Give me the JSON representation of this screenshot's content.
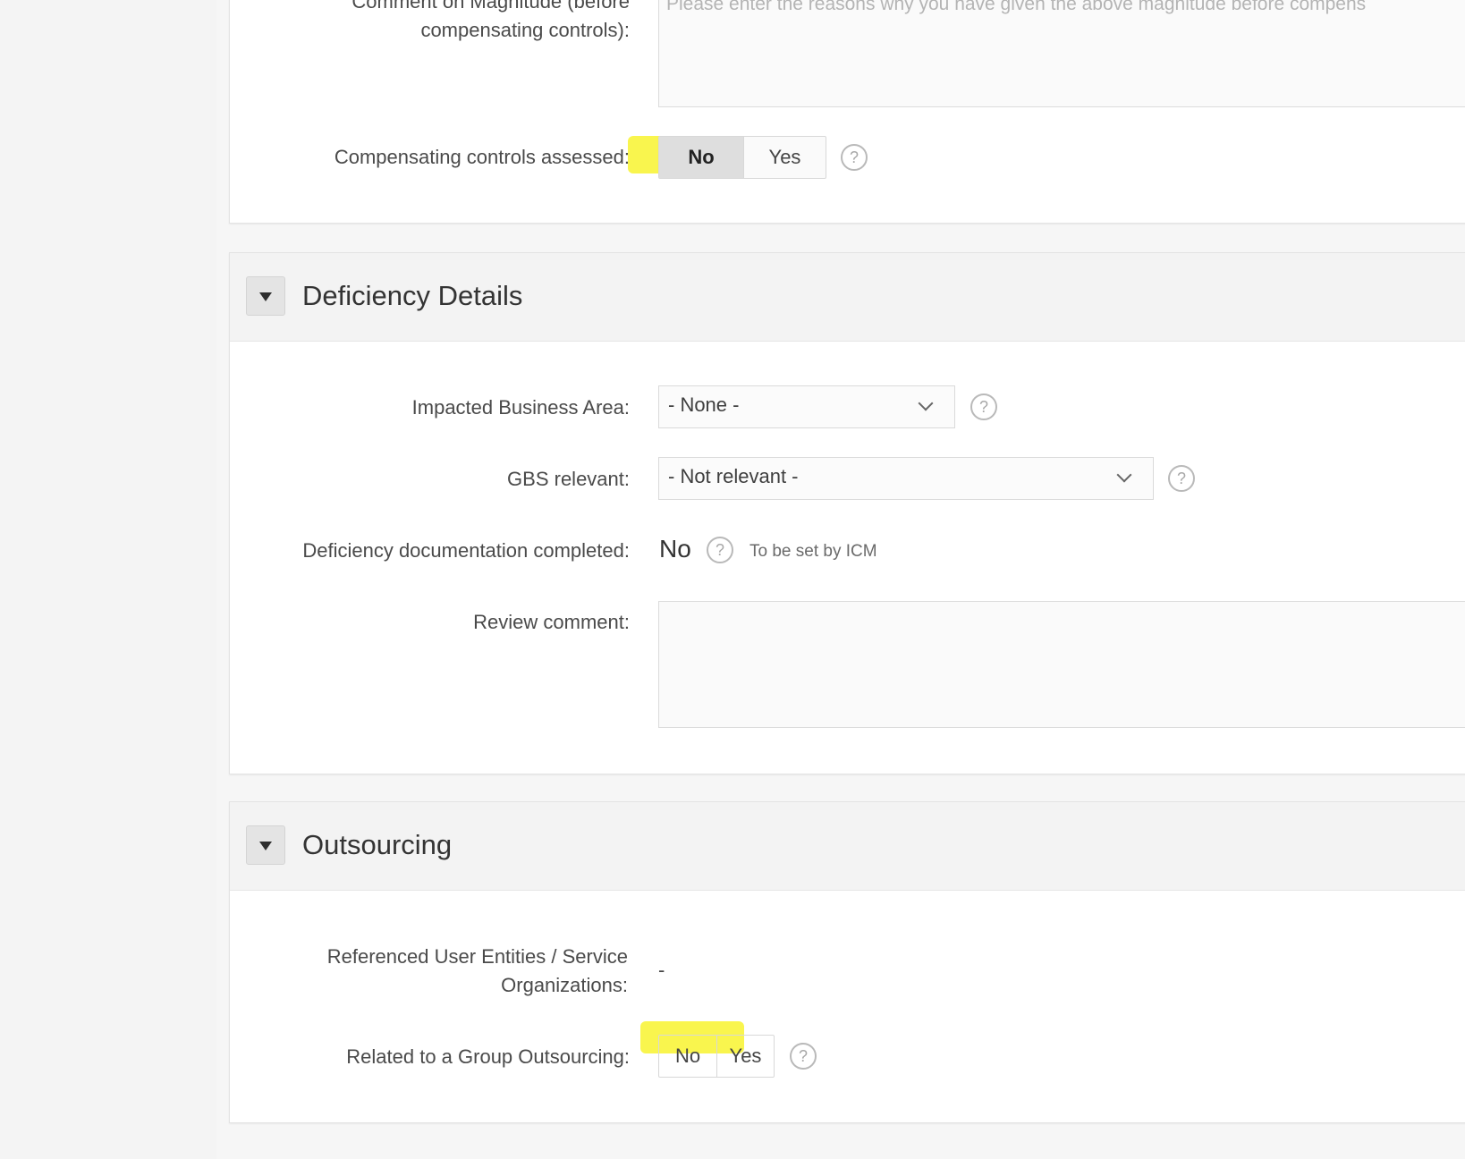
{
  "top_section": {
    "comment_label_line1": "Comment on Magnitude (before",
    "comment_label_line2": "compensating controls):",
    "comment_placeholder": "Please enter the reasons why you have given the above magnitude before compens",
    "compensating_label": "Compensating controls assessed:",
    "compensating_options": [
      "No",
      "Yes"
    ],
    "compensating_selected": "No"
  },
  "deficiency": {
    "title": "Deficiency Details",
    "impacted_label": "Impacted Business Area:",
    "impacted_value": "- None -",
    "gbs_label": "GBS relevant:",
    "gbs_value": "- Not relevant -",
    "doc_label": "Deficiency documentation completed:",
    "doc_value": "No",
    "doc_note": "To be set by ICM",
    "review_label": "Review comment:"
  },
  "outsourcing": {
    "title": "Outsourcing",
    "ref_label_line1": "Referenced User Entities / Service",
    "ref_label_line2": "Organizations:",
    "ref_value": "-",
    "group_label": "Related to a Group Outsourcing:",
    "group_options": [
      "No",
      "Yes"
    ]
  },
  "icons": {
    "help": "help-circle-icon",
    "collapse": "caret-down-icon",
    "dropdown": "chevron-down-icon"
  },
  "colors": {
    "highlight": "#f7f21c"
  }
}
